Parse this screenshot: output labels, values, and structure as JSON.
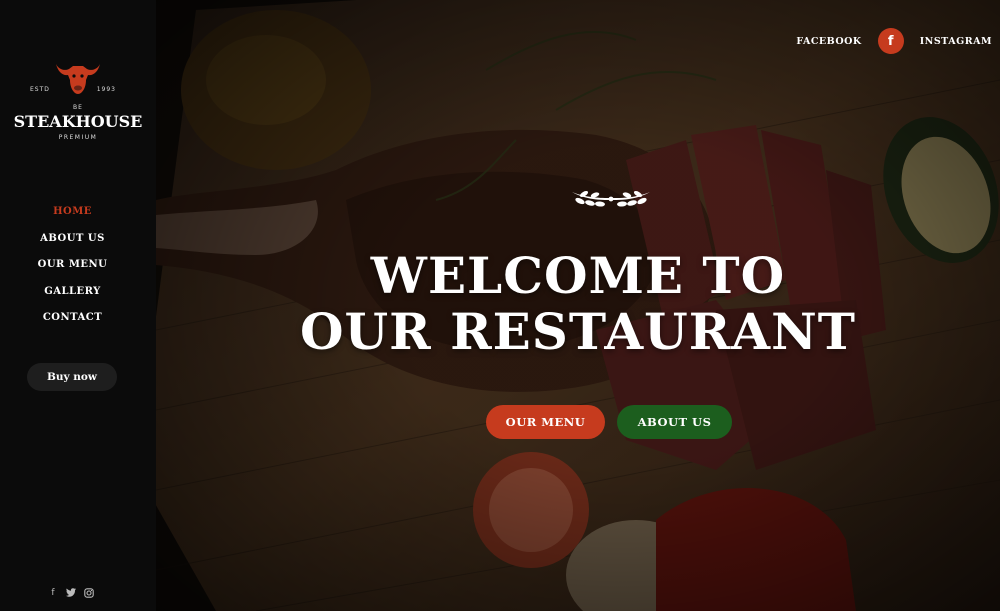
{
  "brand": {
    "estd_left": "ESTD",
    "estd_right": "1993",
    "be": "BE",
    "name": "STEAKHOUSE",
    "tagline": "PREMIUM"
  },
  "nav": {
    "items": [
      {
        "label": "HOME",
        "active": true
      },
      {
        "label": "ABOUT US",
        "active": false
      },
      {
        "label": "OUR MENU",
        "active": false
      },
      {
        "label": "GALLERY",
        "active": false
      },
      {
        "label": "CONTACT",
        "active": false
      }
    ]
  },
  "sidebar": {
    "buy_label": "Buy now",
    "social_icons": [
      "facebook-icon",
      "twitter-icon",
      "instagram-icon"
    ]
  },
  "top_links": {
    "facebook": "FACEBOOK",
    "facebook_icon": "f",
    "instagram": "INSTAGRAM"
  },
  "hero": {
    "headline_line1": "WELCOME TO",
    "headline_line2": "OUR RESTAURANT",
    "menu_button": "OUR MENU",
    "about_button": "ABOUT US"
  },
  "colors": {
    "accent_red": "#c63b1e",
    "accent_green": "#1c5e1e",
    "sidebar_bg": "#0b0b0b"
  }
}
